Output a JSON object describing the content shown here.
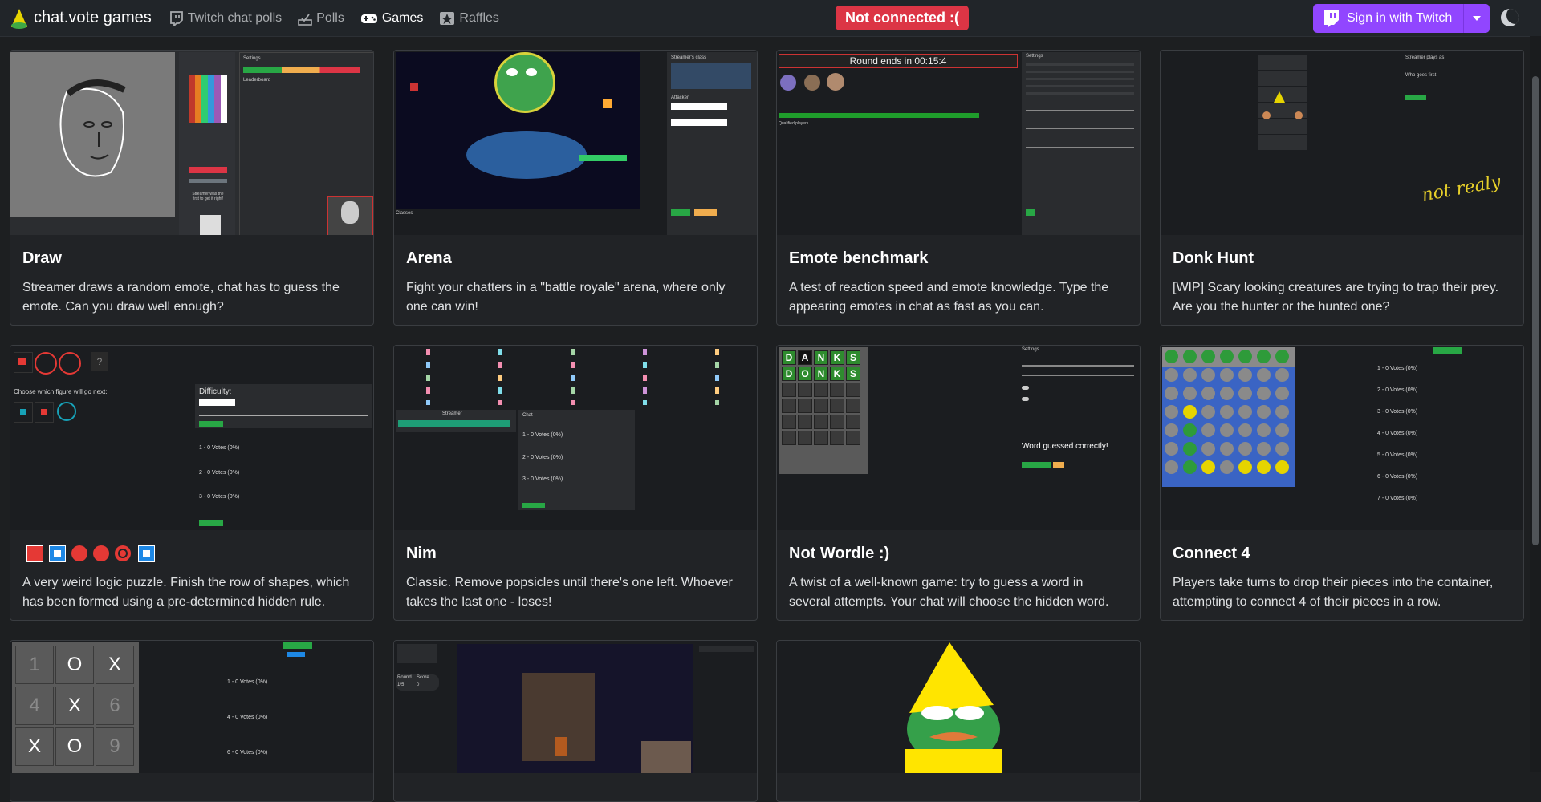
{
  "brand": {
    "name": "chat.vote games"
  },
  "nav": [
    {
      "label": "Twitch chat polls",
      "icon": "twitch-chat-icon"
    },
    {
      "label": "Polls",
      "icon": "polls-icon"
    },
    {
      "label": "Games",
      "icon": "gamepad-icon",
      "active": true
    },
    {
      "label": "Raffles",
      "icon": "star-badge-icon"
    }
  ],
  "status": {
    "text": "Not connected :(",
    "color": "#dc3545"
  },
  "signin": {
    "label": "Sign in with Twitch",
    "color": "#9146ff"
  },
  "games": [
    {
      "title": "Draw",
      "desc": "Streamer draws a random emote, chat has to guess the emote. Can you draw well enough?"
    },
    {
      "title": "Arena",
      "desc": "Fight your chatters in a \"battle royale\" arena, where only one can win!"
    },
    {
      "title": "Emote benchmark",
      "desc": "A test of reaction speed and emote knowledge. Type the appearing emotes in chat as fast as you can."
    },
    {
      "title": "Donk Hunt",
      "desc": "[WIP] Scary looking creatures are trying to trap their prey. Are you the hunter or the hunted one?"
    },
    {
      "title": "",
      "desc": "A very weird logic puzzle. Finish the row of shapes, which has been formed using a pre-determined hidden rule."
    },
    {
      "title": "Nim",
      "desc": "Classic. Remove popsicles until there's one left. Whoever takes the last one - loses!"
    },
    {
      "title": "Not Wordle :)",
      "desc": "A twist of a well-known game: try to guess a word in several attempts. Your chat will choose the hidden word."
    },
    {
      "title": "Connect 4",
      "desc": "Players take turns to drop their pieces into the container, attempting to connect 4 of their pieces in a row."
    },
    {
      "title": "",
      "desc": ""
    },
    {
      "title": "",
      "desc": ""
    },
    {
      "title": "",
      "desc": ""
    }
  ],
  "thumbs": {
    "draw": {
      "leaderboard": "Leaderboard",
      "settings": "Settings",
      "hint": "Streamer was the first to get it right!"
    },
    "arena": {
      "streamer_class": "Streamer's class",
      "attacker": "Attacker",
      "classes": "Classes"
    },
    "emote": {
      "round": "Round ends in 00:15:4",
      "settings": "Settings",
      "qualified": "Qualified players"
    },
    "donk": {
      "note": "not realy",
      "streamer": "Streamer plays as",
      "who_first": "Who goes first"
    },
    "logic": {
      "choose": "Choose which figure will go next:",
      "difficulty": "Difficulty:",
      "votes": [
        "1 - 0 Votes (0%)",
        "2 - 0 Votes (0%)",
        "3 - 0 Votes (0%)"
      ]
    },
    "nim": {
      "streamer": "Streamer",
      "chat": "Chat",
      "votes": [
        "1 - 0 Votes (0%)",
        "2 - 0 Votes (0%)",
        "3 - 0 Votes (0%)"
      ]
    },
    "wordle": {
      "rows": [
        [
          "D",
          "A",
          "N",
          "K",
          "S"
        ],
        [
          "D",
          "O",
          "N",
          "K",
          "S"
        ]
      ],
      "settings": "Settings",
      "guessed": "Word guessed correctly!"
    },
    "connect4": {
      "votes": [
        "1 - 0 Votes (0%)",
        "2 - 0 Votes (0%)",
        "3 - 0 Votes (0%)",
        "4 - 0 Votes (0%)",
        "5 - 0 Votes (0%)",
        "6 - 0 Votes (0%)",
        "7 - 0 Votes (0%)"
      ]
    },
    "ttt": {
      "cells": [
        "1",
        "O",
        "X",
        "4",
        "X",
        "6",
        "X",
        "O",
        "9"
      ],
      "votes": [
        "1 - 0 Votes (0%)",
        "4 - 0 Votes (0%)",
        "6 - 0 Votes (0%)"
      ]
    },
    "dungeon": {
      "round_label": "Round",
      "score_label": "Score",
      "round": "1/5",
      "score": "0"
    }
  }
}
